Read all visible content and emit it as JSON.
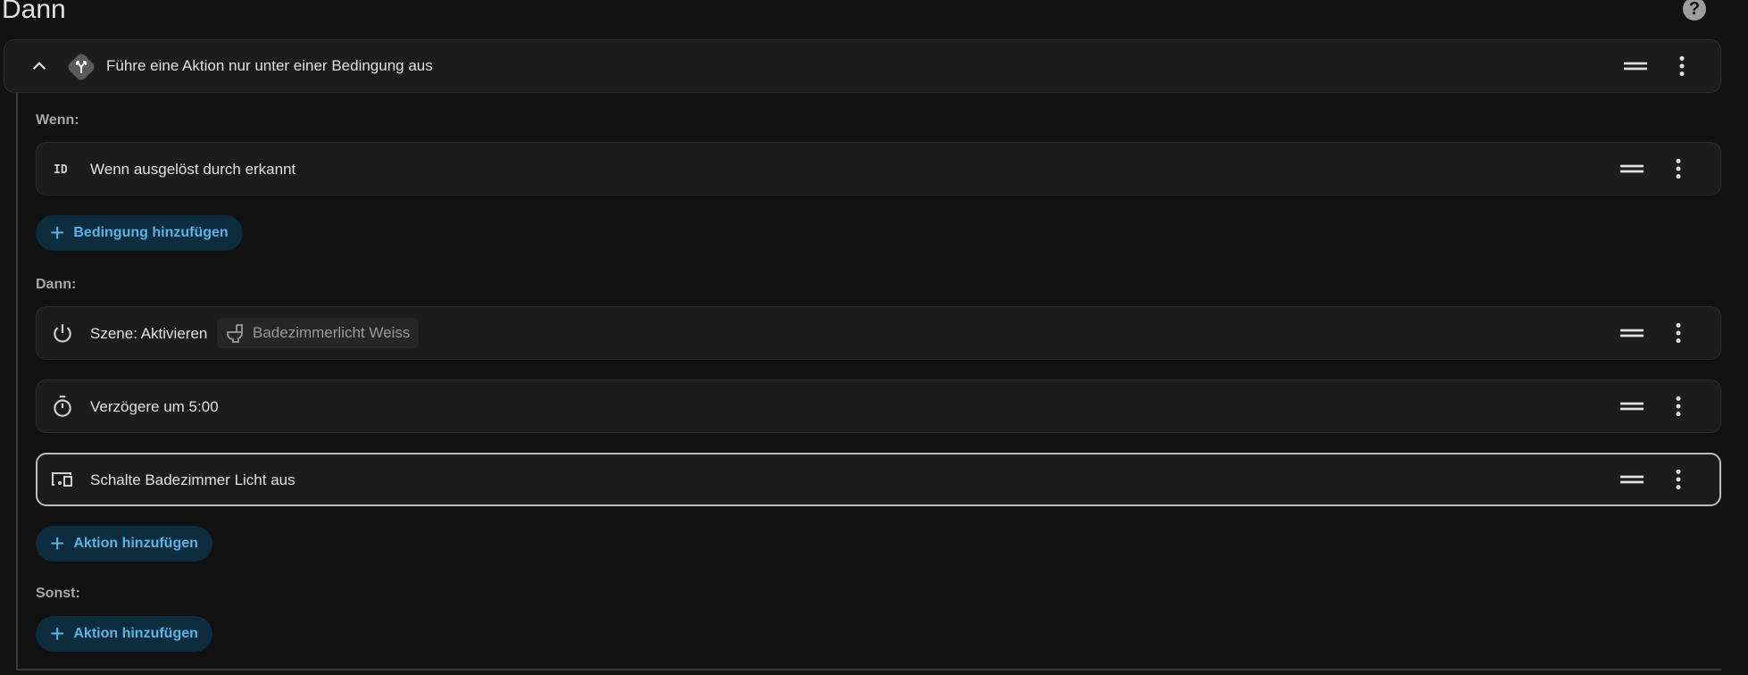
{
  "section": {
    "title": "Dann",
    "help_icon": "help-circle-icon"
  },
  "choose": {
    "title": "Führe eine Aktion nur unter einer Bedingung aus",
    "icon": "source-branch-icon"
  },
  "conditions": {
    "label": "Wenn:",
    "items": [
      {
        "icon": "id-icon",
        "text": "Wenn ausgelöst durch erkannt"
      }
    ],
    "add_label": "Bedingung hinzufügen"
  },
  "then": {
    "label": "Dann:",
    "items": [
      {
        "icon": "power-icon",
        "text": "Szene: Aktivieren",
        "entity": "Badezimmerlicht Weiss",
        "entity_icon": "toilet-icon"
      },
      {
        "icon": "timer-icon",
        "text": "Verzögere um 5:00"
      },
      {
        "icon": "devices-icon",
        "text": "Schalte Badezimmer Licht aus"
      }
    ],
    "add_label": "Aktion hinzufügen"
  },
  "else": {
    "label": "Sonst:",
    "add_label": "Aktion hinzufügen"
  },
  "colors": {
    "background": "#111111",
    "card": "#1c1c1c",
    "accent": "#58b3e6",
    "accent_bg": "#0d2c3e"
  }
}
